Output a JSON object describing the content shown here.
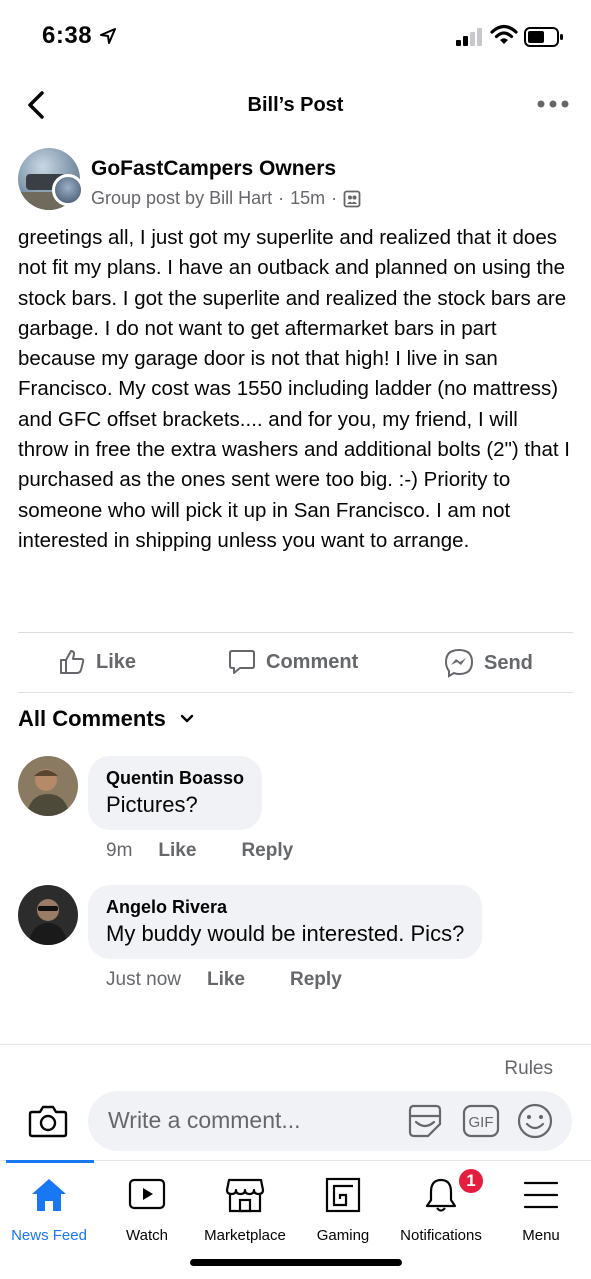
{
  "status_bar": {
    "time": "6:38"
  },
  "header": {
    "title": "Bill’s Post"
  },
  "post": {
    "group_name": "GoFastCampers Owners",
    "byline": "Group post by Bill Hart",
    "time": "15m",
    "text": "greetings all, I just got my superlite and realized that it does not fit my plans. I have an outback and planned on using the stock bars. I got the superlite and realized the stock bars are garbage. I do not want to get aftermarket bars in part because  my garage door is not that high! I live in san Francisco. My cost was 1550 including ladder (no mattress) and GFC offset brackets.... and for you, my friend, I will throw in free the extra washers and additional bolts (2\") that I purchased as the ones sent were too big. :-)  Priority to someone who will pick it up in San Francisco. I am not interested in shipping unless you want to arrange."
  },
  "actions": {
    "like": "Like",
    "comment": "Comment",
    "send": "Send"
  },
  "comments_header": "All Comments",
  "comments": [
    {
      "name": "Quentin Boasso",
      "text": "Pictures?",
      "time": "9m",
      "like": "Like",
      "reply": "Reply"
    },
    {
      "name": "Angelo Rivera",
      "text": "My buddy would be interested. Pics?",
      "time": "Just now",
      "like": "Like",
      "reply": "Reply"
    }
  ],
  "composer": {
    "rules": "Rules",
    "placeholder": "Write a comment...",
    "gif": "GIF"
  },
  "tabs": [
    {
      "label": "News Feed",
      "icon": "home-icon",
      "active": true
    },
    {
      "label": "Watch",
      "icon": "watch-icon"
    },
    {
      "label": "Marketplace",
      "icon": "marketplace-icon"
    },
    {
      "label": "Gaming",
      "icon": "gaming-icon"
    },
    {
      "label": "Notifications",
      "icon": "bell-icon",
      "badge": "1"
    },
    {
      "label": "Menu",
      "icon": "menu-icon"
    }
  ],
  "colors": {
    "accent": "#1877f2",
    "secondary_text": "#65676b",
    "bubble": "#f0f2f5",
    "badge": "#e41e3f"
  }
}
